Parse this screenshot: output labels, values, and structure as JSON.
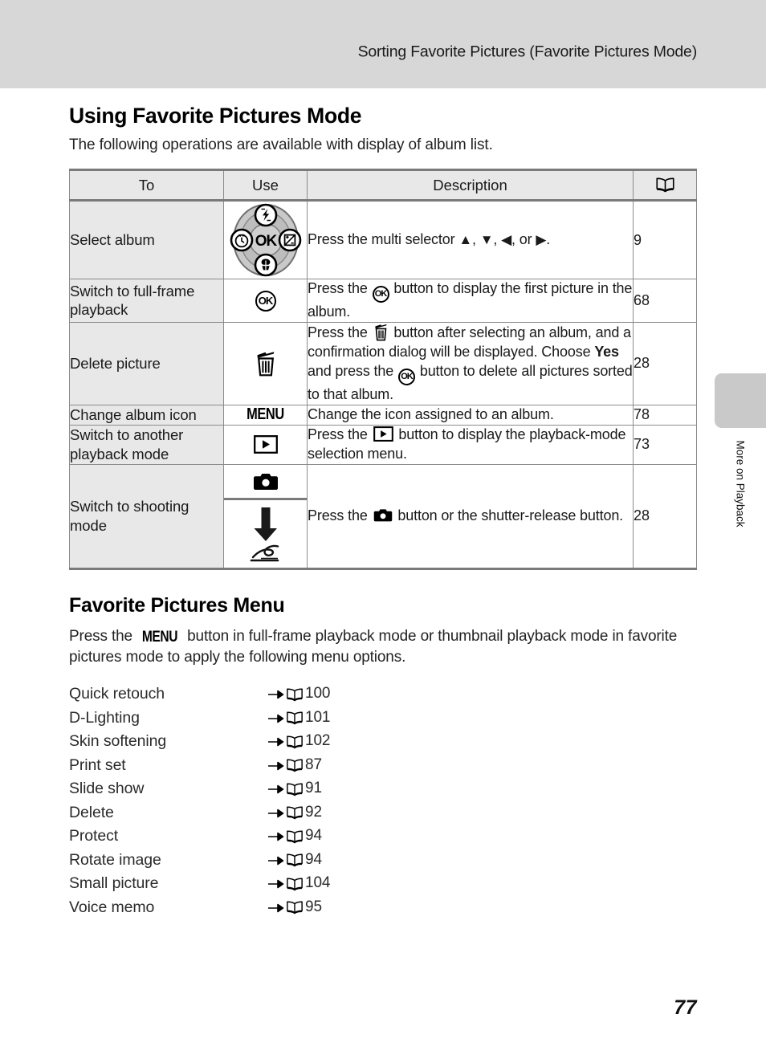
{
  "header": {
    "running_title": "Sorting Favorite Pictures (Favorite Pictures Mode)"
  },
  "side_tab": {
    "label": "More on Playback"
  },
  "section": {
    "title": "Using Favorite Pictures Mode",
    "intro": "The following operations are available with display of album list."
  },
  "table": {
    "headers": {
      "to": "To",
      "use": "Use",
      "description": "Description",
      "reference": "book-icon"
    },
    "rows": [
      {
        "to": "Select album",
        "use_icon": "multi-selector-dial-icon",
        "description_prefix": "Press the multi selector ",
        "description_suffix": ".",
        "description_full": "Press the multi selector ▲, ▼, ◀, or ▶.",
        "reference": "9"
      },
      {
        "to": "Switch to full-frame playback",
        "use_icon": "ok-button-icon",
        "description_full": "Press the OK button to display the first picture in the album.",
        "desc_part1": "Press the ",
        "desc_part2": " button to display the first picture in the album.",
        "reference": "68"
      },
      {
        "to": "Delete picture",
        "use_icon": "trash-button-icon",
        "description_full": "Press the trash button after selecting an album, and a confirmation dialog will be displayed. Choose Yes and press the OK button to delete all pictures sorted to that album.",
        "desc_part1": "Press the ",
        "desc_part2": " button after selecting an album, and a confirmation dialog will be displayed. Choose ",
        "desc_bold": "Yes",
        "desc_part3": " and press the ",
        "desc_part4": " button to delete all pictures sorted to that album.",
        "reference": "28"
      },
      {
        "to": "Change album icon",
        "use_icon": "menu-button-icon",
        "description_full": "Change the icon assigned to an album.",
        "reference": "78"
      },
      {
        "to": "Switch to another playback mode",
        "use_icon": "playback-button-icon",
        "description_full": "Press the playback button to display the playback-mode selection menu.",
        "desc_part1": "Press the ",
        "desc_part2": " button to display the playback-mode selection menu.",
        "reference": "73"
      },
      {
        "to": "Switch to shooting mode",
        "use_icon_top": "camera-button-icon",
        "use_icon_bottom": "shutter-release-button-icon",
        "description_full": "Press the camera button or the shutter-release button.",
        "desc_part1": "Press the ",
        "desc_part2": " button or the shutter-release button.",
        "reference": "28"
      }
    ]
  },
  "menu_section": {
    "title": "Favorite Pictures Menu",
    "intro_part1": "Press the ",
    "intro_menu_icon": "MENU",
    "intro_part2": " button in full-frame playback mode or thumbnail playback mode in favorite pictures mode to apply the following menu options.",
    "intro_full": "Press the MENU button in full-frame playback mode or thumbnail playback mode in favorite pictures mode to apply the following menu options.",
    "options": [
      {
        "name": "Quick retouch",
        "page": "100"
      },
      {
        "name": "D-Lighting",
        "page": "101"
      },
      {
        "name": "Skin softening",
        "page": "102"
      },
      {
        "name": "Print set",
        "page": "87"
      },
      {
        "name": "Slide show",
        "page": "91"
      },
      {
        "name": "Delete",
        "page": "92"
      },
      {
        "name": "Protect",
        "page": "94"
      },
      {
        "name": "Rotate image",
        "page": "94"
      },
      {
        "name": "Small picture",
        "page": "104"
      },
      {
        "name": "Voice memo",
        "page": "95"
      }
    ]
  },
  "footer": {
    "page_number": "77"
  },
  "colors": {
    "header_band": "#d7d7d7",
    "table_head_fill": "#e8e8e8",
    "table_label_fill": "#e8e8e8",
    "table_rule": "#8b8b8b",
    "table_rule_heavy": "#7a7a7a",
    "side_tab": "#c9c9c9"
  }
}
